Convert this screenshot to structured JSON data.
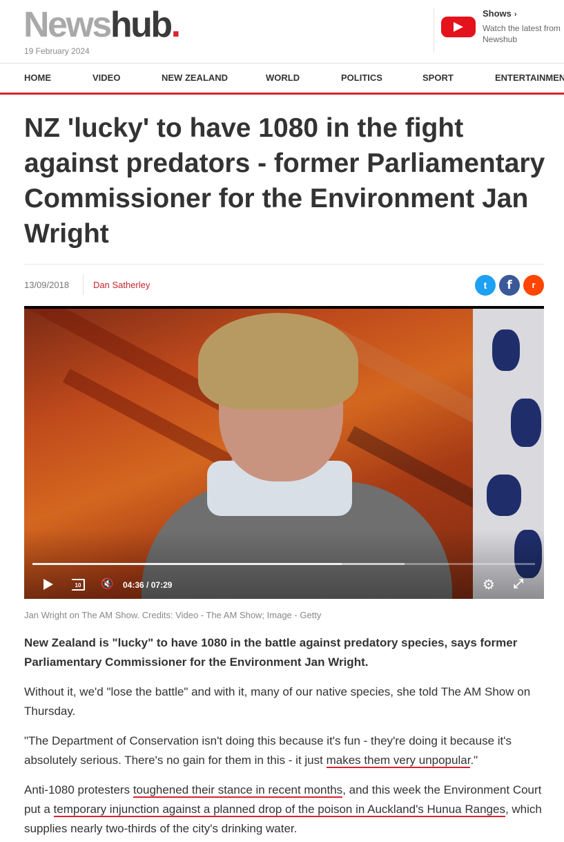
{
  "header": {
    "logo": {
      "news": "News",
      "hub": "hub",
      "dot": "."
    },
    "date": "19 February 2024",
    "shows": {
      "title": "Shows",
      "chevron": "›",
      "description": "Watch the latest from Newshub"
    }
  },
  "nav": {
    "items": [
      "HOME",
      "VIDEO",
      "NEW ZEALAND",
      "WORLD",
      "POLITICS",
      "SPORT",
      "ENTERTAINMENT"
    ]
  },
  "article": {
    "headline": "NZ 'lucky' to have 1080 in the fight against predators - former Parliamentary Commissioner for the Environment Jan Wright",
    "date": "13/09/2018",
    "author": "Dan Satherley",
    "share": {
      "twitter": "t",
      "facebook": "f",
      "reddit": "r"
    },
    "video": {
      "current_time": "04:36",
      "time_separator": "/",
      "duration": "07:29",
      "progress": 0.615,
      "buffered": 0.74,
      "replay_label": "10"
    },
    "caption": "Jan Wright on The AM Show. Credits: Video - The AM Show; Image - Getty",
    "paragraphs": {
      "p1": "New Zealand is \"lucky\" to have 1080 in the battle against predatory species, says former Parliamentary Commissioner for the Environment Jan Wright.",
      "p2": "Without it, we'd \"lose the battle\" and with it, many of our native species, she told The AM Show on Thursday.",
      "p3_before": "\"The Department of Conservation isn't doing this because it's fun - they're doing it because it's absolutely serious. There's no gain for them in this - it just ",
      "p3_link": "makes them very unpopular",
      "p3_after": ".\"",
      "p4_before": "Anti-1080 protesters ",
      "p4_link1": "toughened their stance in recent months",
      "p4_middle": ", and this week the Environment Court put a ",
      "p4_link2": "temporary injunction against a planned drop of the poison in Auckland's Hunua Ranges",
      "p4_after": ", which supplies nearly two-thirds of the city's drinking water."
    }
  },
  "colors": {
    "brand_red": "#d9232d",
    "youtube_red": "#e3121b",
    "twitter": "#1da1f2",
    "facebook": "#3b5998",
    "reddit": "#ff4500"
  }
}
